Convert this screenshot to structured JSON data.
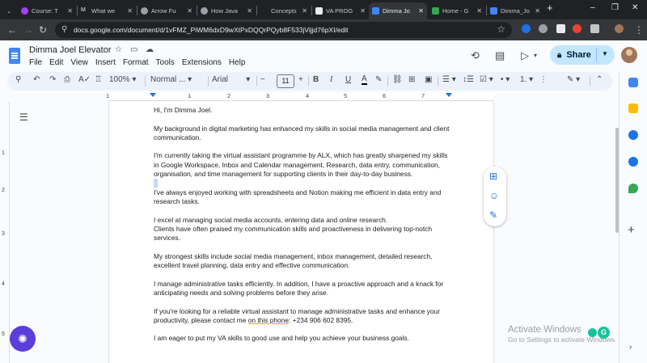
{
  "browser": {
    "tabs": [
      {
        "label": "Course: T",
        "color": "#a142f4"
      },
      {
        "label": "What we",
        "color": "#202124"
      },
      {
        "label": "Arrow Fu",
        "color": "#5f6368"
      },
      {
        "label": "How Java",
        "color": "#5f6368"
      },
      {
        "label": "Concepts",
        "color": "#202124"
      },
      {
        "label": "VA PROG",
        "color": "#5f6368"
      },
      {
        "label": "Dimma Jo",
        "color": "#4285f4"
      },
      {
        "label": "Home - G",
        "color": "#34a853"
      },
      {
        "label": "Dimma_Jo",
        "color": "#4285f4"
      }
    ],
    "new_tab_label": "+",
    "url": "docs.google.com/document/d/1vFMZ_PiWM6dxD9wXtPxDQQrPQyb8F533jVijjd76pXI/edit",
    "window_controls": {
      "minimize": "–",
      "restore": "❐",
      "close": "✕"
    }
  },
  "docs": {
    "title": "Dimma Joel Elevator",
    "menu": [
      "File",
      "Edit",
      "View",
      "Insert",
      "Format",
      "Tools",
      "Extensions",
      "Help"
    ],
    "share_label": "Share",
    "toolbar": {
      "zoom": "100%",
      "style": "Normal ...",
      "font": "Arial",
      "font_size": "11",
      "bold": "B",
      "italic": "I",
      "underline": "U",
      "text_color": "A"
    },
    "ruler_numbers": [
      "1",
      "1",
      "2",
      "3",
      "4",
      "5",
      "6",
      "7"
    ],
    "vruler_numbers": [
      "1",
      "2",
      "3",
      "4",
      "5"
    ],
    "paragraphs": [
      "Hi, I'm Dimma Joel.",
      "My background in digital marketing has enhanced my skills in social media management and client communication.",
      "I'm currently taking the virtual assistant programme by ALX, which has greatly sharpened my skills in Google Workspace, Inbox and Calendar management, Research, data entry, communication, organisation, and time management for supporting clients in their day-to-day business.",
      "I've always enjoyed working with spreadsheets and Notion making me efficient in data entry and research tasks.",
      "I excel at managing social media accounts, entering data and online research.",
      "Clients have often praised my communication skills and proactiveness in delivering top-notch services.",
      "My strongest skills include social media management, inbox management, detailed research, excellent travel planning, data entry and effective communication.",
      "I manage administrative tasks efficiently. In addition, I have a proactive approach and a knack for anticipating needs and solving problems before they arise.",
      "If you're looking for a reliable virtual assistant to manage administrative tasks and enhance your productivity, please contact me ",
      "on this phone",
      ": +234 906 602 8395.",
      "I am eager to put my VA skills to good use and help you achieve your business goals."
    ]
  },
  "overlay": {
    "activate_title": "Activate Windows",
    "activate_sub": "Go to Settings to activate Windows.",
    "grammarly": "G"
  }
}
